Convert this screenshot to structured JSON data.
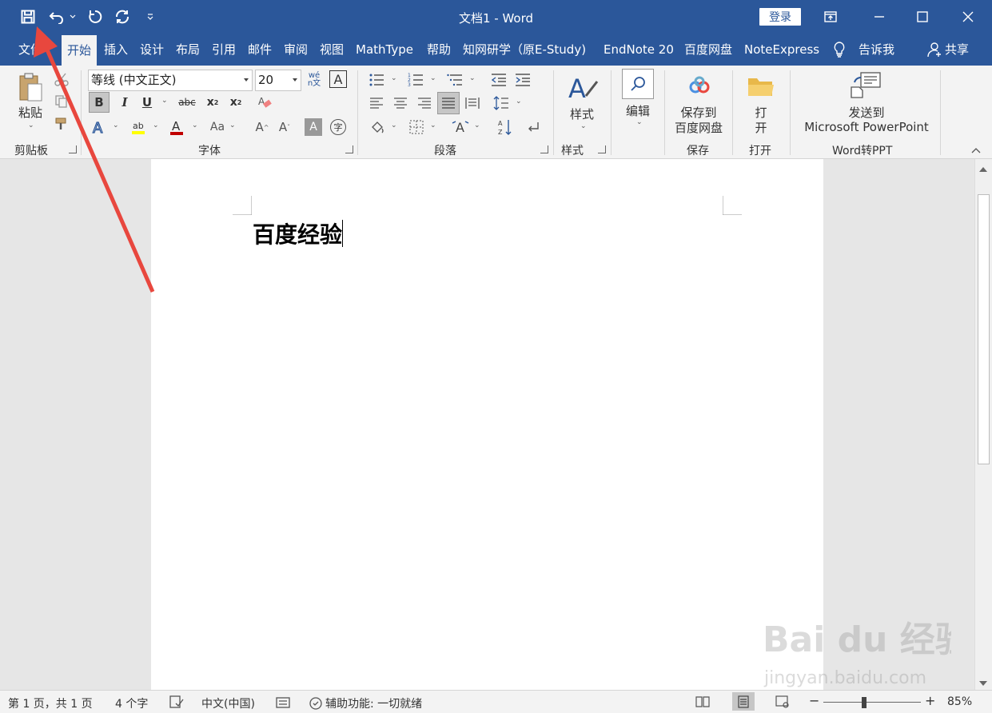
{
  "window": {
    "title": "文档1  -  Word",
    "login_label": "登录"
  },
  "tabs": [
    {
      "label": "文件"
    },
    {
      "label": "开始"
    },
    {
      "label": "插入"
    },
    {
      "label": "设计"
    },
    {
      "label": "布局"
    },
    {
      "label": "引用"
    },
    {
      "label": "邮件"
    },
    {
      "label": "审阅"
    },
    {
      "label": "视图"
    },
    {
      "label": "MathType"
    },
    {
      "label": "帮助"
    },
    {
      "label": "知网研学（原E-Study)"
    },
    {
      "label": "EndNote 20"
    },
    {
      "label": "百度网盘"
    },
    {
      "label": "NoteExpress"
    },
    {
      "label": "告诉我"
    },
    {
      "label": "共享"
    }
  ],
  "ribbon": {
    "clipboard": {
      "paste_label": "粘贴",
      "group_label": "剪贴板"
    },
    "font": {
      "name": "等线 (中文正文)",
      "size": "20",
      "group_label": "字体",
      "phonetic_label": "wén文",
      "border_char": "A",
      "bold": "B",
      "italic": "I",
      "underline": "U",
      "strike": "abc",
      "aa_label": "Aa",
      "enclose_char": "字"
    },
    "paragraph": {
      "group_label": "段落"
    },
    "styles": {
      "label": "样式",
      "group_label": "样式"
    },
    "editing": {
      "label": "编辑"
    },
    "baidu": {
      "line1": "保存到",
      "line2": "百度网盘",
      "group_label": "保存"
    },
    "open": {
      "line1": "打",
      "line2": "开",
      "group_label": "打开"
    },
    "ppt": {
      "line1": "发送到",
      "line2": "Microsoft PowerPoint",
      "group_label": "Word转PPT"
    }
  },
  "document": {
    "text": "百度经验"
  },
  "status": {
    "page": "第 1 页，共 1 页",
    "words": "4 个字",
    "language": "中文(中国)",
    "accessibility": "辅助功能: 一切就绪",
    "zoom": "85%"
  },
  "watermark": {
    "text": "Bai du 经验",
    "url": "jingyan.baidu.com"
  },
  "colors": {
    "brand": "#2b579a",
    "highlight": "#ffff00",
    "font_color": "#c00000",
    "annotation_arrow": "#e8473e"
  }
}
